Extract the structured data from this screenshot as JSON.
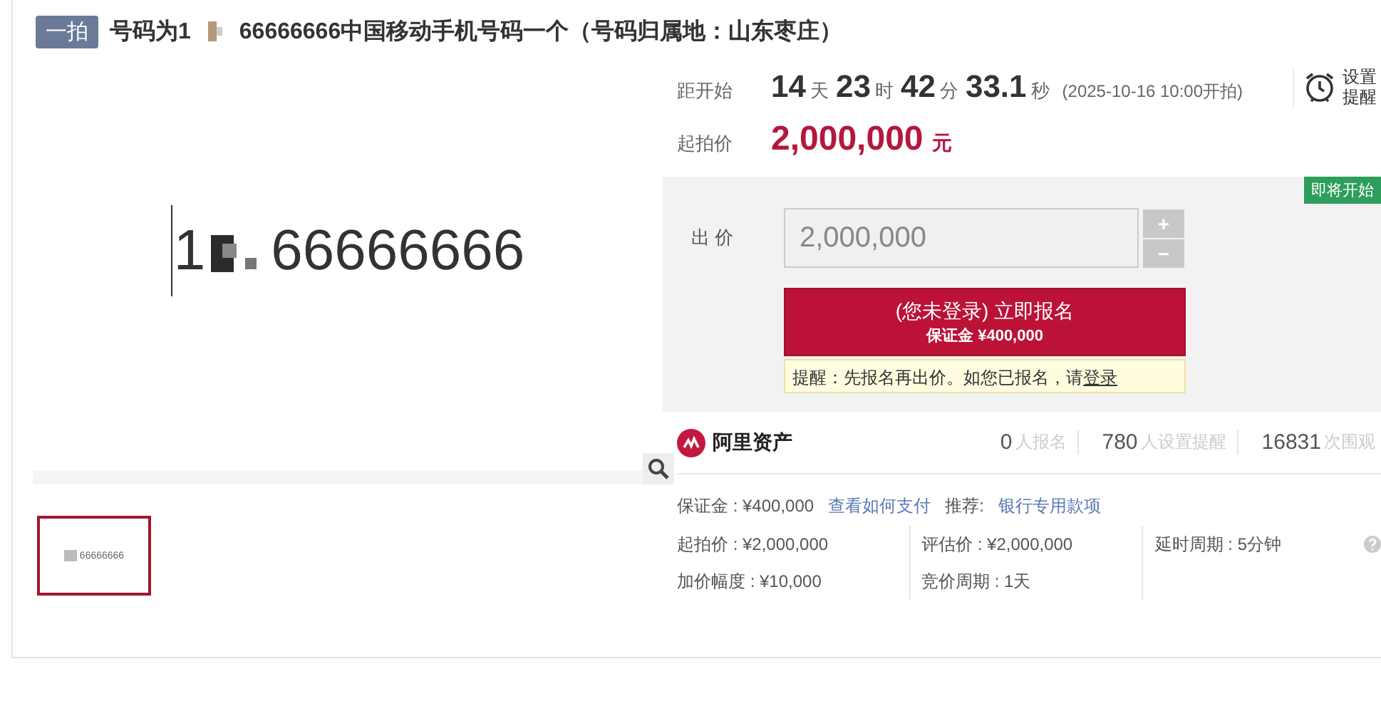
{
  "header": {
    "badge": "一拍",
    "title_start": "号码为1",
    "title_end": "66666666中国移动手机号码一个（号码归属地：山东枣庄）"
  },
  "preview": {
    "number_start": "1",
    "number_end": "66666666",
    "thumbnail": {
      "label": "66666666",
      "selected": true
    }
  },
  "countdown": {
    "label": "距开始",
    "parts": [
      {
        "value": "14",
        "unit": "天"
      },
      {
        "value": "23",
        "unit": "时"
      },
      {
        "value": "42",
        "unit": "分"
      },
      {
        "value": "33.1",
        "unit": "秒"
      }
    ],
    "start_note": "(2025-10-16 10:00开拍)"
  },
  "reminder": {
    "label": "设置提醒"
  },
  "start_price": {
    "label": "起拍价",
    "value": "2,000,000",
    "unit": "元"
  },
  "bid": {
    "status": "即将开始",
    "label": "出 价",
    "placeholder": "2,000,000",
    "plus": "+",
    "minus": "−",
    "button_title": "(您未登录) 立即报名",
    "button_subtitle": "保证金 ¥400,000",
    "notice": "提醒：先报名再出价。如您已报名，请",
    "notice_link": "登录"
  },
  "stats": {
    "brand": "阿里资产",
    "items": [
      {
        "value": "0",
        "label": "人报名"
      },
      {
        "value": "780",
        "label": "人设置提醒"
      },
      {
        "value": "16831",
        "label": "次围观"
      }
    ]
  },
  "details": {
    "deposit": "保证金 : ¥400,000",
    "deposit_link": "查看如何支付",
    "recommend": "推荐:",
    "recommend_link": "银行专用款项",
    "columns": [
      [
        "起拍价 : ¥2,000,000",
        "加价幅度 : ¥10,000"
      ],
      [
        "评估价 : ¥2,000,000",
        "竞价周期 : 1天"
      ],
      [
        "延时周期 : 5分钟"
      ]
    ]
  }
}
